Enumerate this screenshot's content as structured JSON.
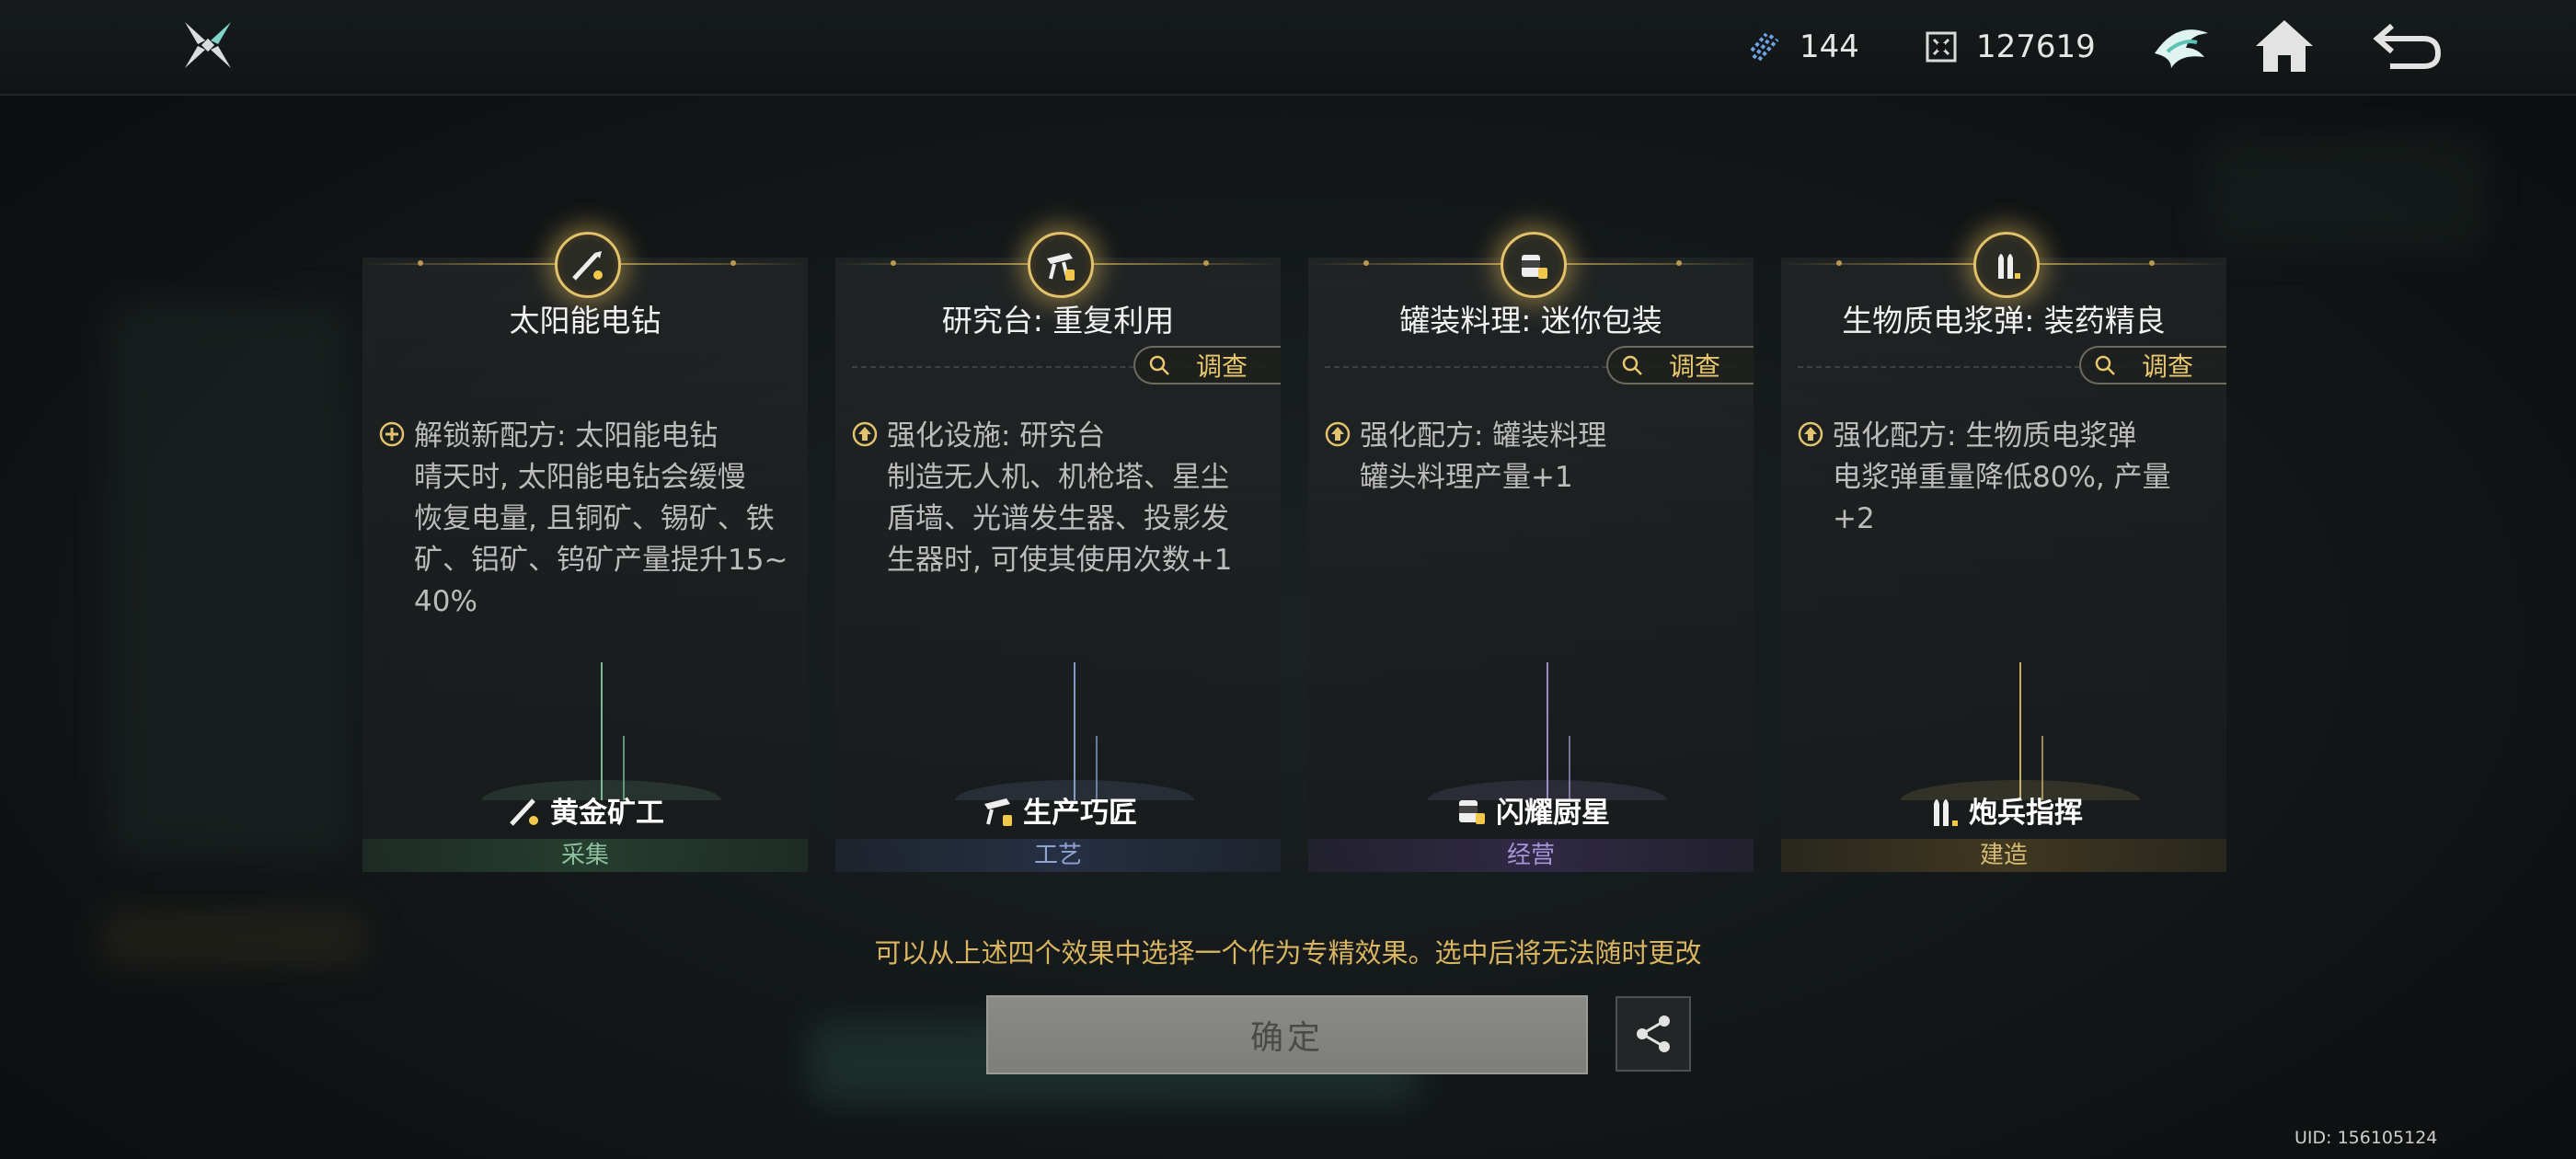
{
  "topbar": {
    "resource_1": "144",
    "resource_2": "127619"
  },
  "cards": [
    {
      "title": "太阳能电钻",
      "effect_lines": [
        "解锁新配方: 太阳能电钻",
        "晴天时, 太阳能电钻会缓慢",
        "恢复电量, 且铜矿、锡矿、铁",
        "矿、铝矿、钨矿产量提升15~",
        "40%"
      ],
      "bottom_name": "黄金矿工",
      "category": "采集",
      "category_color": "#2f5a3f",
      "category_text_color": "#8fbf9c",
      "ray_color": "#8fe0b0",
      "bullet": "unlock-icon"
    },
    {
      "title": "研究台: 重复利用",
      "investigate": "调查",
      "effect_lines": [
        "强化设施: 研究台",
        "制造无人机、机枪塔、星尘",
        "盾墙、光谱发生器、投影发",
        "生器时, 可使其使用次数+1"
      ],
      "bottom_name": "生产巧匠",
      "category": "工艺",
      "category_color": "#2f3d5e",
      "category_text_color": "#8fa4d0",
      "ray_color": "#9fb8f0",
      "bullet": "upgrade-icon"
    },
    {
      "title": "罐装料理: 迷你包装",
      "investigate": "调查",
      "effect_lines": [
        "强化配方: 罐装料理",
        "罐头料理产量+1"
      ],
      "bottom_name": "闪耀厨星",
      "category": "经营",
      "category_color": "#3f3260",
      "category_text_color": "#a895d8",
      "ray_color": "#b9a6f0",
      "bullet": "upgrade-icon"
    },
    {
      "title": "生物质电浆弹: 装药精良",
      "investigate": "调查",
      "effect_lines": [
        "强化配方: 生物质电浆弹",
        "电浆弹重量降低80%, 产量",
        "+2"
      ],
      "bottom_name": "炮兵指挥",
      "category": "建造",
      "category_color": "#5a4a22",
      "category_text_color": "#d4bb75",
      "ray_color": "#f0d27a",
      "bullet": "upgrade-icon"
    }
  ],
  "hint": "可以从上述四个效果中选择一个作为专精效果。选中后将无法随时更改",
  "confirm_label": "确定",
  "uid": "UID: 156105124",
  "colors": {
    "gold": "#e2c26c",
    "hint": "#d9b561"
  }
}
